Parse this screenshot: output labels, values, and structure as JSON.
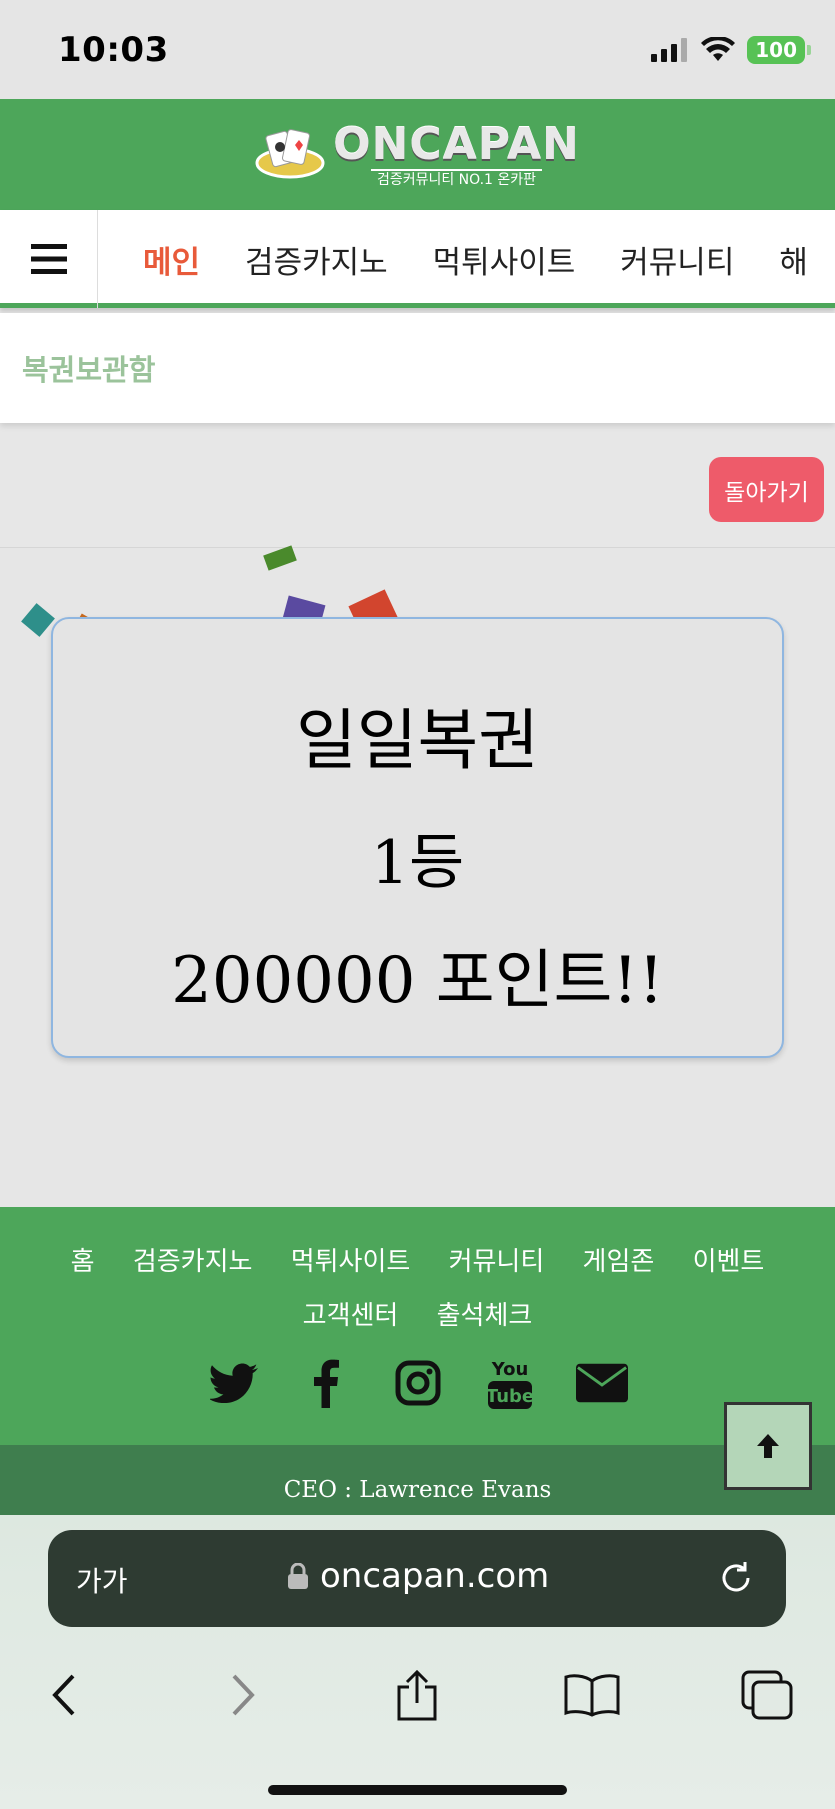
{
  "status_bar": {
    "time": "10:03",
    "battery": "100"
  },
  "header": {
    "logo_main": "ONCAPAN",
    "logo_sub": "검증커뮤니티 NO.1 온카판"
  },
  "nav": {
    "items": [
      {
        "label": "메인",
        "active": true
      },
      {
        "label": "검증카지노"
      },
      {
        "label": "먹튀사이트"
      },
      {
        "label": "커뮤니티"
      },
      {
        "label": "해"
      }
    ]
  },
  "page": {
    "title": "복권보관함",
    "back_label": "돌아가기"
  },
  "result": {
    "line1": "일일복권",
    "line2": "1등",
    "line3": "200000 포인트!!"
  },
  "footer": {
    "links_row1": [
      "홈",
      "검증카지노",
      "먹튀사이트",
      "커뮤니티",
      "게임존",
      "이벤트"
    ],
    "links_row2": [
      "고객센터",
      "출석체크"
    ],
    "social": [
      "twitter-icon",
      "facebook-icon",
      "instagram-icon",
      "youtube-icon",
      "email-icon"
    ],
    "youtube_text_top": "You",
    "youtube_text_bottom": "Tube",
    "ceo": "CEO : Lawrence Evans"
  },
  "browser": {
    "aa_label": "가가",
    "url": "oncapan.com"
  },
  "colors": {
    "brand_green": "#4da65a",
    "accent_red": "#ee5b6a",
    "active_nav": "#e85a3a"
  }
}
